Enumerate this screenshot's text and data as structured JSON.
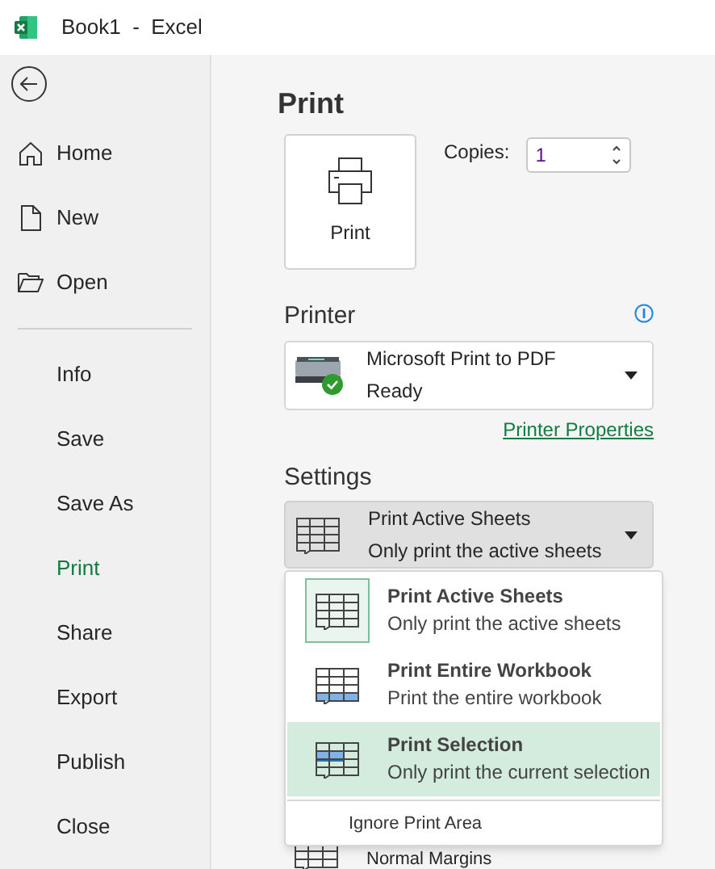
{
  "window": {
    "title": "Book1  -  Excel"
  },
  "sidebar": {
    "items": [
      {
        "label": "Home",
        "kind": "home",
        "selected": false
      },
      {
        "label": "New",
        "kind": "new",
        "selected": false
      },
      {
        "label": "Open",
        "kind": "open",
        "selected": false
      },
      {
        "kind": "divider"
      },
      {
        "label": "Info",
        "kind": "plain",
        "selected": false
      },
      {
        "label": "Save",
        "kind": "plain",
        "selected": false
      },
      {
        "label": "Save As",
        "kind": "plain",
        "selected": false
      },
      {
        "label": "Print",
        "kind": "plain",
        "selected": true
      },
      {
        "label": "Share",
        "kind": "plain",
        "selected": false
      },
      {
        "label": "Export",
        "kind": "plain",
        "selected": false
      },
      {
        "label": "Publish",
        "kind": "plain",
        "selected": false
      },
      {
        "label": "Close",
        "kind": "plain",
        "selected": false
      }
    ]
  },
  "main": {
    "title": "Print",
    "print_button": "Print",
    "copies": {
      "label": "Copies:",
      "value": "1"
    },
    "printer": {
      "heading": "Printer",
      "name": "Microsoft Print to PDF",
      "status": "Ready",
      "properties_link": "Printer Properties"
    },
    "settings": {
      "heading": "Settings",
      "current": {
        "title": "Print Active Sheets",
        "subtitle": "Only print the active sheets"
      },
      "menu": [
        {
          "kind": "active",
          "title": "Print Active Sheets",
          "subtitle": "Only print the active sheets",
          "selected": true,
          "highlighted": false
        },
        {
          "kind": "workbook",
          "title": "Print Entire Workbook",
          "subtitle": "Print the entire workbook",
          "selected": false,
          "highlighted": false
        },
        {
          "kind": "selection",
          "title": "Print Selection",
          "subtitle": "Only print the current selection",
          "selected": false,
          "highlighted": true
        }
      ],
      "menu_option": "Ignore Print Area",
      "next_item": "Normal Margins"
    }
  }
}
